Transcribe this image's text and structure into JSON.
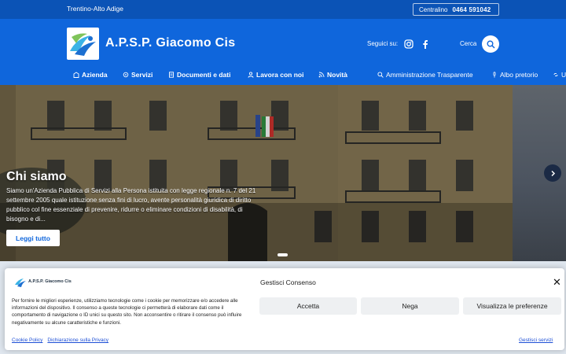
{
  "topbar": {
    "region": "Trentino-Alto Adige",
    "phone_label": "Centralino",
    "phone_number": "0464 591042"
  },
  "header": {
    "title": "A.P.S.P. Giacomo Cis",
    "follow_label": "Seguici su:",
    "social_icons": [
      "instagram-icon",
      "facebook-icon"
    ],
    "search_label": "Cerca"
  },
  "nav": {
    "items": [
      {
        "label": "Azienda",
        "icon": "building-icon"
      },
      {
        "label": "Servizi",
        "icon": "services-icon"
      },
      {
        "label": "Documenti e dati",
        "icon": "document-icon"
      },
      {
        "label": "Lavora con noi",
        "icon": "person-icon"
      },
      {
        "label": "Novità",
        "icon": "rss-icon"
      }
    ],
    "right_items": [
      {
        "label": "Amministrazione Trasparente",
        "icon": "search-icon"
      },
      {
        "label": "Albo pretorio",
        "icon": "pin-icon"
      },
      {
        "label": "U",
        "icon": "link-icon"
      }
    ]
  },
  "hero": {
    "title": "Chi siamo",
    "text": "Siamo un'Azienda Pubblica di Servizi alla Persona istituita con legge regionale n. 7 del 21 settembre 2005 quale istituzione senza fini di lucro, avente personalità giuridica di diritto pubblico col fine essenziale di prevenire, ridurre o eliminare condizioni di disabilità, di bisogno e di...",
    "button": "Leggi tutto"
  },
  "consent": {
    "logo_text": "A.P.S.P. Giacomo Cis",
    "title": "Gestisci Consenso",
    "text": "Per fornire le migliori esperienze, utilizziamo tecnologie come i cookie per memorizzare e/o accedere alle informazioni del dispositivo. Il consenso a queste tecnologie ci permetterà di elaborare dati come il comportamento di navigazione o ID unici su questo sito. Non acconsentire o ritirare il consenso può influire negativamente su alcune caratteristiche e funzioni.",
    "accept": "Accetta",
    "deny": "Nega",
    "preferences": "Visualizza le preferenze",
    "cookie_policy": "Cookie Policy",
    "privacy": "Dichiarazione sulla Privacy",
    "manage": "Gestisci servizi"
  },
  "colors": {
    "primary": "#0f66dc",
    "topbar": "#0b53b6",
    "button_bg": "#eef0f2"
  }
}
